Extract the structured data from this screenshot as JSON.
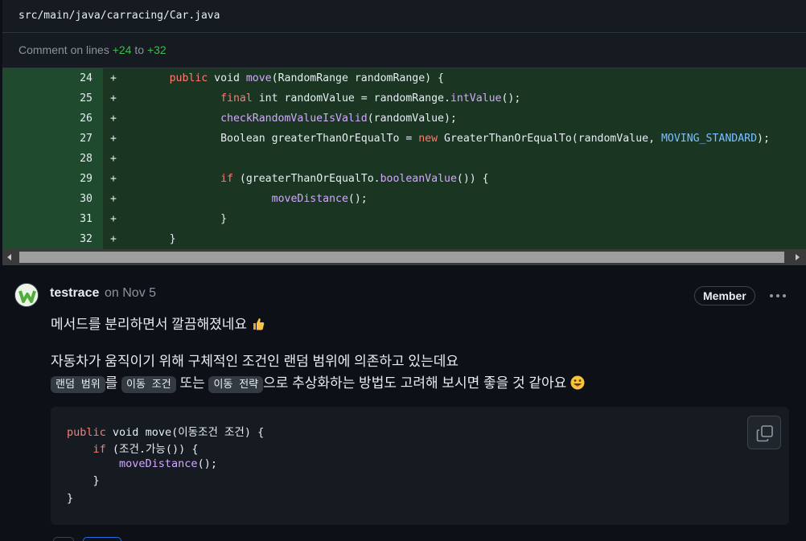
{
  "file": {
    "path": "src/main/java/carracing/Car.java"
  },
  "comment_range": {
    "prefix": "Comment on lines ",
    "start": "+24",
    "middle": " to ",
    "end": "+32"
  },
  "diff_lines": [
    {
      "num": "24",
      "sign": "+",
      "segments": [
        [
          "",
          "       "
        ],
        [
          "kw",
          "public"
        ],
        [
          "",
          " void "
        ],
        [
          "fn",
          "move"
        ],
        [
          "",
          "(RandomRange randomRange) {"
        ]
      ]
    },
    {
      "num": "25",
      "sign": "+",
      "segments": [
        [
          "",
          "               "
        ],
        [
          "kw",
          "final"
        ],
        [
          "",
          " int randomValue = randomRange."
        ],
        [
          "fn",
          "intValue"
        ],
        [
          "",
          "();"
        ]
      ]
    },
    {
      "num": "26",
      "sign": "+",
      "segments": [
        [
          "",
          "               "
        ],
        [
          "fn",
          "checkRandomValueIsValid"
        ],
        [
          "",
          "(randomValue);"
        ]
      ]
    },
    {
      "num": "27",
      "sign": "+",
      "segments": [
        [
          "",
          "               Boolean greaterThanOrEqualTo = "
        ],
        [
          "kw",
          "new"
        ],
        [
          "",
          " GreaterThanOrEqualTo(randomValue, "
        ],
        [
          "cst",
          "MOVING_STANDARD"
        ],
        [
          "",
          ");"
        ]
      ]
    },
    {
      "num": "28",
      "sign": "+",
      "segments": [
        [
          "",
          ""
        ]
      ]
    },
    {
      "num": "29",
      "sign": "+",
      "segments": [
        [
          "",
          "               "
        ],
        [
          "kw",
          "if"
        ],
        [
          "",
          " (greaterThanOrEqualTo."
        ],
        [
          "fn",
          "booleanValue"
        ],
        [
          "",
          "()) {"
        ]
      ]
    },
    {
      "num": "30",
      "sign": "+",
      "segments": [
        [
          "",
          "                       "
        ],
        [
          "fn",
          "moveDistance"
        ],
        [
          "",
          "();"
        ]
      ]
    },
    {
      "num": "31",
      "sign": "+",
      "segments": [
        [
          "",
          "               }"
        ]
      ]
    },
    {
      "num": "32",
      "sign": "+",
      "segments": [
        [
          "",
          "       }"
        ]
      ]
    }
  ],
  "comment": {
    "author": "testrace",
    "date": "on Nov 5",
    "badge": "Member",
    "menu_icon": "kebab-horizontal-icon",
    "line1": "메서드를 분리하면서 깔끔해졌네요",
    "line1_emoji": "thumbs-up-emoji",
    "line2": "자동차가 움직이기 위해 구체적인 조건인 랜덤 범위에 의존하고 있는데요",
    "line3": {
      "code1": "랜덤 범위",
      "t1": "를 ",
      "code2": "이동 조건",
      "t2": " 또는 ",
      "code3": "이동 전략",
      "t3": "으로 추상화하는 방법도 고려해 보시면 좋을 것 같아요",
      "emoji": "grinning-tongue-emoji"
    },
    "code_lines": [
      [
        [
          "kw",
          "public"
        ],
        [
          "",
          " void "
        ],
        [
          "fnw",
          "move"
        ],
        [
          "",
          "(이동조건 조건) {"
        ]
      ],
      [
        [
          "",
          "    "
        ],
        [
          "kw",
          "if"
        ],
        [
          "",
          " (조건.가능()) {"
        ]
      ],
      [
        [
          "",
          "        "
        ],
        [
          "fn",
          "moveDistance"
        ],
        [
          "",
          "();"
        ]
      ],
      [
        [
          "",
          "    }"
        ]
      ],
      [
        [
          "",
          "}"
        ]
      ]
    ],
    "copy_icon": "copy-icon"
  },
  "colors": {
    "added_bg": "#1b3523",
    "added_gutter": "#1f4a2d",
    "keyword": "#ff7b72",
    "function": "#d2a8ff",
    "constant": "#79c0ff",
    "line_num_accent": "#3fb950"
  }
}
